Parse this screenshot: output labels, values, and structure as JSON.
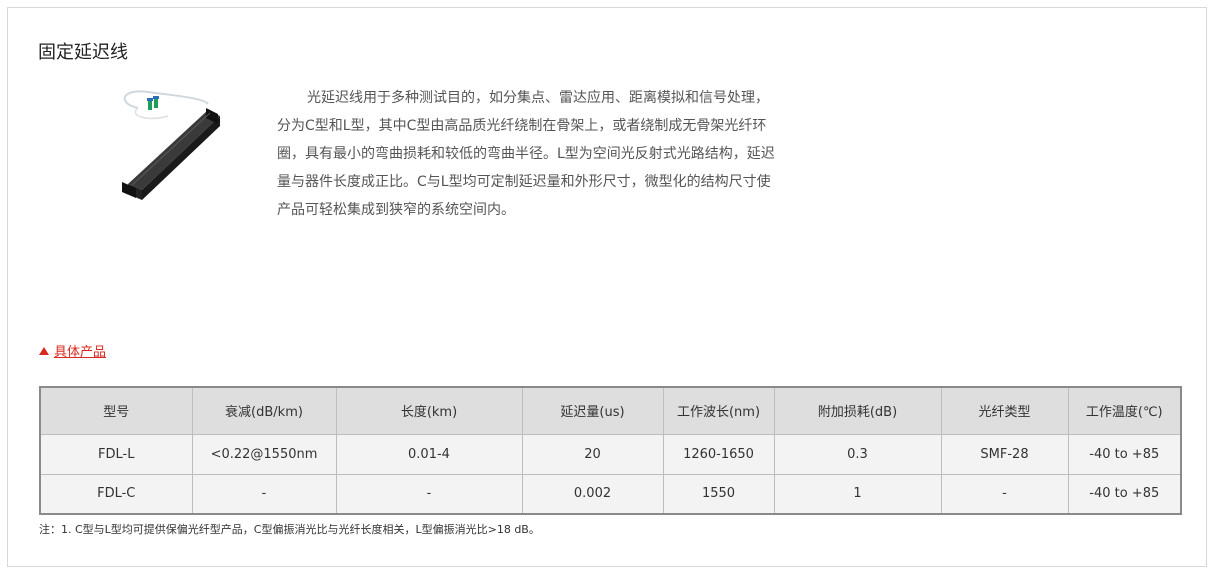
{
  "page": {
    "title": "固定延迟线",
    "description": "光延迟线用于多种测试目的，如分集点、雷达应用、距离模拟和信号处理，分为C型和L型，其中C型由高品质光纤绕制在骨架上，或者绕制成无骨架光纤环圈，具有最小的弯曲损耗和较低的弯曲半径。L型为空间光反射式光路结构，延迟量与器件长度成正比。C与L型均可定制延迟量和外形尺寸，微型化的结构尺寸使产品可轻松集成到狭窄的系统空间内。",
    "product_image_icon": "fiber-delay-line-device",
    "section_link": "具体产品",
    "accent_color": "#d9281f"
  },
  "table": {
    "headers": [
      "型号",
      "衰减(dB/km)",
      "长度(km)",
      "延迟量(us)",
      "工作波长(nm)",
      "附加损耗(dB)",
      "光纤类型",
      "工作温度(℃)"
    ],
    "rows": [
      [
        "FDL-L",
        "<0.22@1550nm",
        "0.01-4",
        "20",
        "1260-1650",
        "0.3",
        "SMF-28",
        "-40 to +85"
      ],
      [
        "FDL-C",
        "-",
        "-",
        "0.002",
        "1550",
        "1",
        "-",
        "-40 to +85"
      ]
    ]
  },
  "note": "注：1. C型与L型均可提供保偏光纤型产品，C型偏振消光比与光纤长度相关，L型偏振消光比>18 dB。"
}
